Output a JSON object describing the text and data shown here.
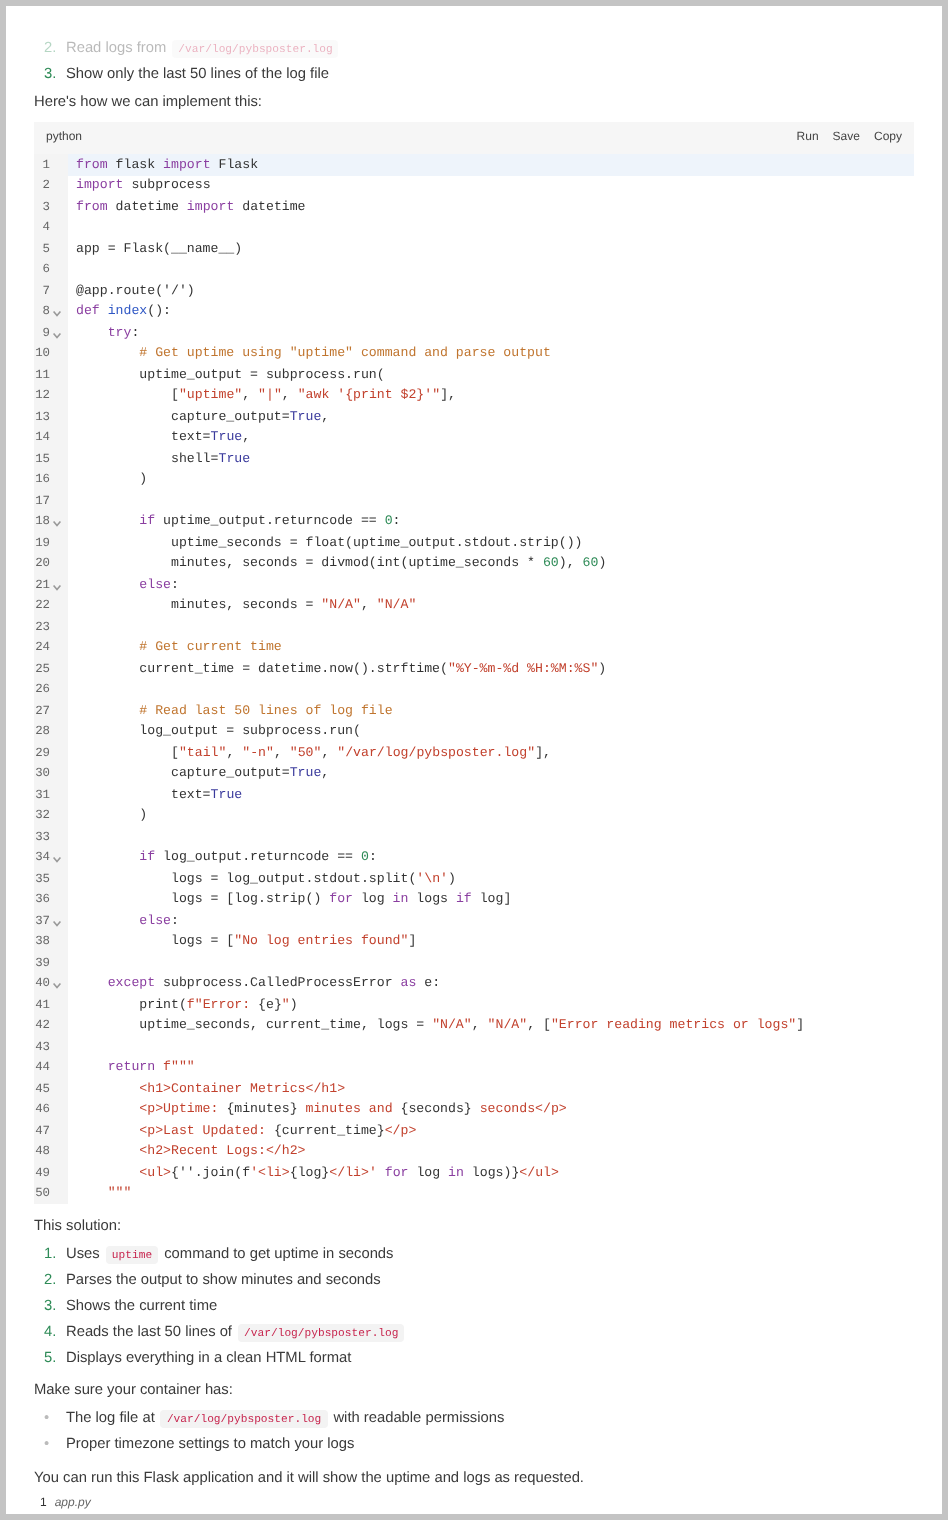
{
  "intro_list": [
    {
      "number": "2.",
      "faded": true,
      "parts": [
        {
          "text": "Read logs from ",
          "kind": "text"
        },
        {
          "text": "/var/log/pybsposter.log",
          "kind": "code"
        }
      ]
    },
    {
      "number": "3.",
      "faded": false,
      "parts": [
        {
          "text": "Show only the last 50 lines of the log file",
          "kind": "text"
        }
      ]
    }
  ],
  "intro_text": "Here's how we can implement this:",
  "code_block": {
    "language": "python",
    "actions": [
      "Run",
      "Save",
      "Copy"
    ],
    "lines": [
      {
        "number": "1",
        "current": true,
        "foldable": false,
        "tokens": [
          {
            "text": "from",
            "kind": "kw"
          },
          {
            "text": " flask ",
            "kind": "plain"
          },
          {
            "text": "import",
            "kind": "kw"
          },
          {
            "text": " Flask",
            "kind": "plain"
          }
        ]
      },
      {
        "number": "2",
        "current": false,
        "foldable": false,
        "tokens": [
          {
            "text": "import",
            "kind": "kw"
          },
          {
            "text": " subprocess",
            "kind": "plain"
          }
        ]
      },
      {
        "number": "3",
        "current": false,
        "foldable": false,
        "tokens": [
          {
            "text": "from",
            "kind": "kw"
          },
          {
            "text": " datetime ",
            "kind": "plain"
          },
          {
            "text": "import",
            "kind": "kw"
          },
          {
            "text": " datetime",
            "kind": "plain"
          }
        ]
      },
      {
        "number": "4",
        "current": false,
        "foldable": false
      },
      {
        "number": "5",
        "current": false,
        "foldable": false,
        "tokens": [
          {
            "text": "app = Flask(__name__)",
            "kind": "plain"
          }
        ]
      },
      {
        "number": "6",
        "current": false,
        "foldable": false
      },
      {
        "number": "7",
        "current": false,
        "foldable": false,
        "tokens": [
          {
            "text": "@app.route('/')",
            "kind": "plain"
          }
        ]
      },
      {
        "number": "8",
        "current": false,
        "foldable": true,
        "tokens": [
          {
            "text": "def ",
            "kind": "kw"
          },
          {
            "text": "index",
            "kind": "fn"
          },
          {
            "text": "():",
            "kind": "plain"
          }
        ]
      },
      {
        "number": "9",
        "current": false,
        "foldable": true,
        "tokens": [
          {
            "text": "    try",
            "kind": "kw"
          },
          {
            "text": ":",
            "kind": "plain"
          }
        ]
      },
      {
        "number": "10",
        "current": false,
        "foldable": false,
        "tokens": [
          {
            "text": "        # Get uptime using \"uptime\" command and parse output",
            "kind": "cmt"
          }
        ]
      },
      {
        "number": "11",
        "current": false,
        "foldable": false,
        "tokens": [
          {
            "text": "        uptime_output = subprocess.run(",
            "kind": "plain"
          }
        ]
      },
      {
        "number": "12",
        "current": false,
        "foldable": false,
        "tokens": [
          {
            "text": "            [",
            "kind": "plain"
          },
          {
            "text": "\"uptime\"",
            "kind": "str"
          },
          {
            "text": ", ",
            "kind": "plain"
          },
          {
            "text": "\"|\"",
            "kind": "str"
          },
          {
            "text": ", ",
            "kind": "plain"
          },
          {
            "text": "\"awk '{print $2}'\"",
            "kind": "str"
          },
          {
            "text": "],",
            "kind": "plain"
          }
        ]
      },
      {
        "number": "13",
        "current": false,
        "foldable": false,
        "tokens": [
          {
            "text": "            capture_output=",
            "kind": "plain"
          },
          {
            "text": "True",
            "kind": "bool"
          },
          {
            "text": ",",
            "kind": "plain"
          }
        ]
      },
      {
        "number": "14",
        "current": false,
        "foldable": false,
        "tokens": [
          {
            "text": "            text=",
            "kind": "plain"
          },
          {
            "text": "True",
            "kind": "bool"
          },
          {
            "text": ",",
            "kind": "plain"
          }
        ]
      },
      {
        "number": "15",
        "current": false,
        "foldable": false,
        "tokens": [
          {
            "text": "            shell=",
            "kind": "plain"
          },
          {
            "text": "True",
            "kind": "bool"
          }
        ]
      },
      {
        "number": "16",
        "current": false,
        "foldable": false,
        "tokens": [
          {
            "text": "        )",
            "kind": "plain"
          }
        ]
      },
      {
        "number": "17",
        "current": false,
        "foldable": false
      },
      {
        "number": "18",
        "current": false,
        "foldable": true,
        "tokens": [
          {
            "text": "        if",
            "kind": "kw"
          },
          {
            "text": " uptime_output.returncode == ",
            "kind": "plain"
          },
          {
            "text": "0",
            "kind": "num"
          },
          {
            "text": ":",
            "kind": "plain"
          }
        ]
      },
      {
        "number": "19",
        "current": false,
        "foldable": false,
        "tokens": [
          {
            "text": "            uptime_seconds = float(uptime_output.stdout.strip())",
            "kind": "plain"
          }
        ]
      },
      {
        "number": "20",
        "current": false,
        "foldable": false,
        "tokens": [
          {
            "text": "            minutes, seconds = divmod(int(uptime_seconds * ",
            "kind": "plain"
          },
          {
            "text": "60",
            "kind": "num"
          },
          {
            "text": "), ",
            "kind": "plain"
          },
          {
            "text": "60",
            "kind": "num"
          },
          {
            "text": ")",
            "kind": "plain"
          }
        ]
      },
      {
        "number": "21",
        "current": false,
        "foldable": true,
        "tokens": [
          {
            "text": "        else",
            "kind": "kw"
          },
          {
            "text": ":",
            "kind": "plain"
          }
        ]
      },
      {
        "number": "22",
        "current": false,
        "foldable": false,
        "tokens": [
          {
            "text": "            minutes, seconds = ",
            "kind": "plain"
          },
          {
            "text": "\"N/A\"",
            "kind": "str"
          },
          {
            "text": ", ",
            "kind": "plain"
          },
          {
            "text": "\"N/A\"",
            "kind": "str"
          }
        ]
      },
      {
        "number": "23",
        "current": false,
        "foldable": false
      },
      {
        "number": "24",
        "current": false,
        "foldable": false,
        "tokens": [
          {
            "text": "        # Get current time",
            "kind": "cmt"
          }
        ]
      },
      {
        "number": "25",
        "current": false,
        "foldable": false,
        "tokens": [
          {
            "text": "        current_time = datetime.now().strftime(",
            "kind": "plain"
          },
          {
            "text": "\"%Y-%m-%d %H:%M:%S\"",
            "kind": "str"
          },
          {
            "text": ")",
            "kind": "plain"
          }
        ]
      },
      {
        "number": "26",
        "current": false,
        "foldable": false
      },
      {
        "number": "27",
        "current": false,
        "foldable": false,
        "tokens": [
          {
            "text": "        # Read last 50 lines of log file",
            "kind": "cmt"
          }
        ]
      },
      {
        "number": "28",
        "current": false,
        "foldable": false,
        "tokens": [
          {
            "text": "        log_output = subprocess.run(",
            "kind": "plain"
          }
        ]
      },
      {
        "number": "29",
        "current": false,
        "foldable": false,
        "tokens": [
          {
            "text": "            [",
            "kind": "plain"
          },
          {
            "text": "\"tail\"",
            "kind": "str"
          },
          {
            "text": ", ",
            "kind": "plain"
          },
          {
            "text": "\"-n\"",
            "kind": "str"
          },
          {
            "text": ", ",
            "kind": "plain"
          },
          {
            "text": "\"50\"",
            "kind": "str"
          },
          {
            "text": ", ",
            "kind": "plain"
          },
          {
            "text": "\"/var/log/pybsposter.log\"",
            "kind": "str"
          },
          {
            "text": "],",
            "kind": "plain"
          }
        ]
      },
      {
        "number": "30",
        "current": false,
        "foldable": false,
        "tokens": [
          {
            "text": "            capture_output=",
            "kind": "plain"
          },
          {
            "text": "True",
            "kind": "bool"
          },
          {
            "text": ",",
            "kind": "plain"
          }
        ]
      },
      {
        "number": "31",
        "current": false,
        "foldable": false,
        "tokens": [
          {
            "text": "            text=",
            "kind": "plain"
          },
          {
            "text": "True",
            "kind": "bool"
          }
        ]
      },
      {
        "number": "32",
        "current": false,
        "foldable": false,
        "tokens": [
          {
            "text": "        )",
            "kind": "plain"
          }
        ]
      },
      {
        "number": "33",
        "current": false,
        "foldable": false
      },
      {
        "number": "34",
        "current": false,
        "foldable": true,
        "tokens": [
          {
            "text": "        if",
            "kind": "kw"
          },
          {
            "text": " log_output.returncode == ",
            "kind": "plain"
          },
          {
            "text": "0",
            "kind": "num"
          },
          {
            "text": ":",
            "kind": "plain"
          }
        ]
      },
      {
        "number": "35",
        "current": false,
        "foldable": false,
        "tokens": [
          {
            "text": "            logs = log_output.stdout.split(",
            "kind": "plain"
          },
          {
            "text": "'\\n'",
            "kind": "str"
          },
          {
            "text": ")",
            "kind": "plain"
          }
        ]
      },
      {
        "number": "36",
        "current": false,
        "foldable": false,
        "tokens": [
          {
            "text": "            logs = [log.strip() ",
            "kind": "plain"
          },
          {
            "text": "for",
            "kind": "kw"
          },
          {
            "text": " log ",
            "kind": "plain"
          },
          {
            "text": "in",
            "kind": "kw"
          },
          {
            "text": " logs ",
            "kind": "plain"
          },
          {
            "text": "if",
            "kind": "kw"
          },
          {
            "text": " log]",
            "kind": "plain"
          }
        ]
      },
      {
        "number": "37",
        "current": false,
        "foldable": true,
        "tokens": [
          {
            "text": "        else",
            "kind": "kw"
          },
          {
            "text": ":",
            "kind": "plain"
          }
        ]
      },
      {
        "number": "38",
        "current": false,
        "foldable": false,
        "tokens": [
          {
            "text": "            logs = [",
            "kind": "plain"
          },
          {
            "text": "\"No log entries found\"",
            "kind": "str"
          },
          {
            "text": "]",
            "kind": "plain"
          }
        ]
      },
      {
        "number": "39",
        "current": false,
        "foldable": false
      },
      {
        "number": "40",
        "current": false,
        "foldable": true,
        "tokens": [
          {
            "text": "    except",
            "kind": "kw"
          },
          {
            "text": " subprocess.CalledProcessError ",
            "kind": "plain"
          },
          {
            "text": "as",
            "kind": "kw"
          },
          {
            "text": " e:",
            "kind": "plain"
          }
        ]
      },
      {
        "number": "41",
        "current": false,
        "foldable": false,
        "tokens": [
          {
            "text": "        print(",
            "kind": "plain"
          },
          {
            "text": "f\"Error: ",
            "kind": "str"
          },
          {
            "text": "{e}",
            "kind": "plain"
          },
          {
            "text": "\"",
            "kind": "str"
          },
          {
            "text": ")",
            "kind": "plain"
          }
        ]
      },
      {
        "number": "42",
        "current": false,
        "foldable": false,
        "tokens": [
          {
            "text": "        uptime_seconds, current_time, logs = ",
            "kind": "plain"
          },
          {
            "text": "\"N/A\"",
            "kind": "str"
          },
          {
            "text": ", ",
            "kind": "plain"
          },
          {
            "text": "\"N/A\"",
            "kind": "str"
          },
          {
            "text": ", [",
            "kind": "plain"
          },
          {
            "text": "\"Error reading metrics or logs\"",
            "kind": "str"
          },
          {
            "text": "]",
            "kind": "plain"
          }
        ]
      },
      {
        "number": "43",
        "current": false,
        "foldable": false
      },
      {
        "number": "44",
        "current": false,
        "foldable": false,
        "tokens": [
          {
            "text": "    return ",
            "kind": "kw"
          },
          {
            "text": "f\"\"\"",
            "kind": "str"
          }
        ]
      },
      {
        "number": "45",
        "current": false,
        "foldable": false,
        "tokens": [
          {
            "text": "        <h1>Container Metrics</h1>",
            "kind": "str"
          }
        ]
      },
      {
        "number": "46",
        "current": false,
        "foldable": false,
        "tokens": [
          {
            "text": "        <p>Uptime: ",
            "kind": "str"
          },
          {
            "text": "{minutes}",
            "kind": "plain"
          },
          {
            "text": " minutes and ",
            "kind": "str"
          },
          {
            "text": "{seconds}",
            "kind": "plain"
          },
          {
            "text": " seconds</p>",
            "kind": "str"
          }
        ]
      },
      {
        "number": "47",
        "current": false,
        "foldable": false,
        "tokens": [
          {
            "text": "        <p>Last Updated: ",
            "kind": "str"
          },
          {
            "text": "{current_time}",
            "kind": "plain"
          },
          {
            "text": "</p>",
            "kind": "str"
          }
        ]
      },
      {
        "number": "48",
        "current": false,
        "foldable": false,
        "tokens": [
          {
            "text": "        <h2>Recent Logs:</h2>",
            "kind": "str"
          }
        ]
      },
      {
        "number": "49",
        "current": false,
        "foldable": false,
        "tokens": [
          {
            "text": "        <ul>",
            "kind": "str"
          },
          {
            "text": "{''.join(f",
            "kind": "plain"
          },
          {
            "text": "'<li>",
            "kind": "str"
          },
          {
            "text": "{log}",
            "kind": "plain"
          },
          {
            "text": "</li>' ",
            "kind": "str"
          },
          {
            "text": "for",
            "kind": "kw"
          },
          {
            "text": " log ",
            "kind": "plain"
          },
          {
            "text": "in",
            "kind": "kw"
          },
          {
            "text": " logs)}",
            "kind": "plain"
          },
          {
            "text": "</ul>",
            "kind": "str"
          }
        ]
      },
      {
        "number": "50",
        "current": false,
        "foldable": false,
        "tokens": [
          {
            "text": "    \"\"\"",
            "kind": "str"
          }
        ]
      }
    ]
  },
  "summary_heading": "This solution:",
  "steps": [
    {
      "number": "1.",
      "parts": [
        {
          "text": "Uses ",
          "kind": "text"
        },
        {
          "text": "uptime",
          "kind": "code"
        },
        {
          "text": " command to get uptime in seconds",
          "kind": "text"
        }
      ]
    },
    {
      "number": "2.",
      "parts": [
        {
          "text": "Parses the output to show minutes and seconds",
          "kind": "text"
        }
      ]
    },
    {
      "number": "3.",
      "parts": [
        {
          "text": "Shows the current time",
          "kind": "text"
        }
      ]
    },
    {
      "number": "4.",
      "parts": [
        {
          "text": "Reads the last 50 lines of ",
          "kind": "text"
        },
        {
          "text": "/var/log/pybsposter.log",
          "kind": "code"
        }
      ]
    },
    {
      "number": "5.",
      "parts": [
        {
          "text": "Displays everything in a clean HTML format",
          "kind": "text"
        }
      ]
    }
  ],
  "requirements_heading": "Make sure your container has:",
  "requirements": [
    {
      "marker": "•",
      "parts": [
        {
          "text": "The log file at ",
          "kind": "text"
        },
        {
          "text": "/var/log/pybsposter.log",
          "kind": "code"
        },
        {
          "text": " with readable permissions",
          "kind": "text"
        }
      ]
    },
    {
      "marker": "•",
      "parts": [
        {
          "text": "Proper timezone settings to match your logs",
          "kind": "text"
        }
      ]
    }
  ],
  "closing_text": "You can run this Flask application and it will show the uptime and logs as requested.",
  "attachment": {
    "count": "1",
    "filename": "app.py"
  }
}
